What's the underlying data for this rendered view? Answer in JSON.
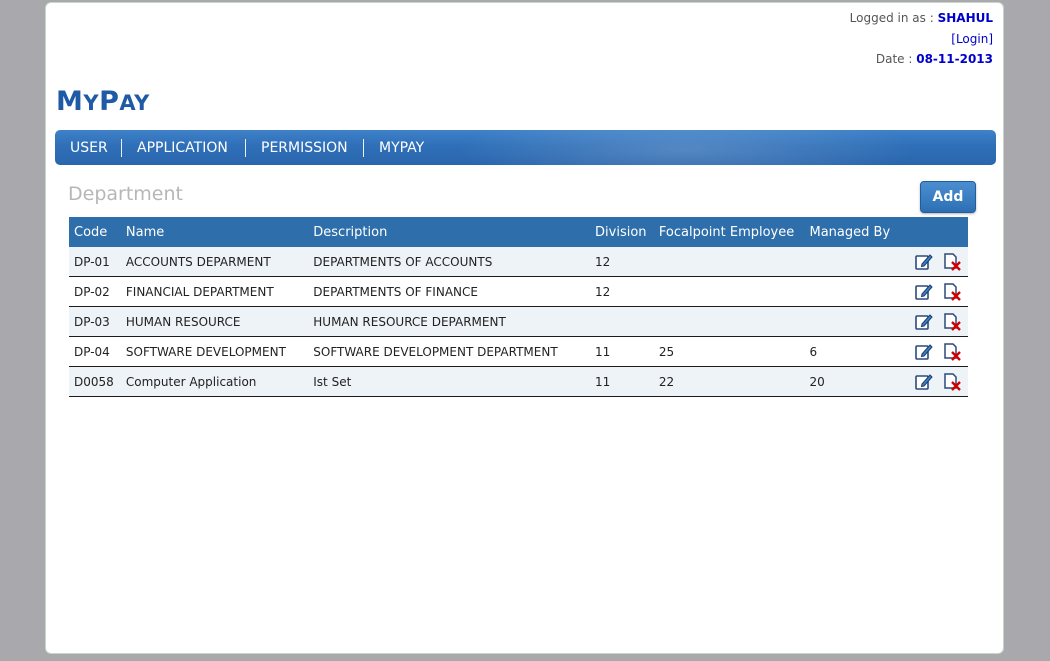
{
  "header": {
    "logged_in_label": "Logged in as :",
    "username": "SHAHUL",
    "login_link": "Login",
    "date_label": "Date :",
    "date": "08-11-2013"
  },
  "logo": {
    "first_big": "M",
    "first_small": "Y",
    "second_big": "P",
    "second_small": "AY"
  },
  "nav": {
    "items": [
      "USER",
      "APPLICATION",
      "PERMISSION",
      "MYPAY"
    ]
  },
  "page": {
    "title": "Department",
    "add_label": "Add"
  },
  "table": {
    "columns": [
      "Code",
      "Name",
      "Description",
      "Division",
      "Focalpoint Employee",
      "Managed By"
    ],
    "rows": [
      {
        "code": "DP-01",
        "name": "ACCOUNTS DEPARMENT",
        "description": "DEPARTMENTS OF ACCOUNTS",
        "division": "12",
        "focal": "",
        "managed": ""
      },
      {
        "code": "DP-02",
        "name": "FINANCIAL DEPARTMENT",
        "description": "DEPARTMENTS OF FINANCE",
        "division": "12",
        "focal": "",
        "managed": ""
      },
      {
        "code": "DP-03",
        "name": "HUMAN RESOURCE",
        "description": "HUMAN RESOURCE DEPARMENT",
        "division": "",
        "focal": "",
        "managed": ""
      },
      {
        "code": "DP-04",
        "name": "SOFTWARE DEVELOPMENT",
        "description": "SOFTWARE DEVELOPMENT DEPARTMENT",
        "division": "11",
        "focal": "25",
        "managed": "6"
      },
      {
        "code": "D0058",
        "name": "Computer Application",
        "description": "Ist Set",
        "division": "11",
        "focal": "22",
        "managed": "20"
      }
    ]
  },
  "icons": {
    "edit": "edit-icon",
    "delete": "delete-icon"
  },
  "colors": {
    "accent": "#2e6fab",
    "link": "#0000cc",
    "logo": "#1f5aa6"
  }
}
